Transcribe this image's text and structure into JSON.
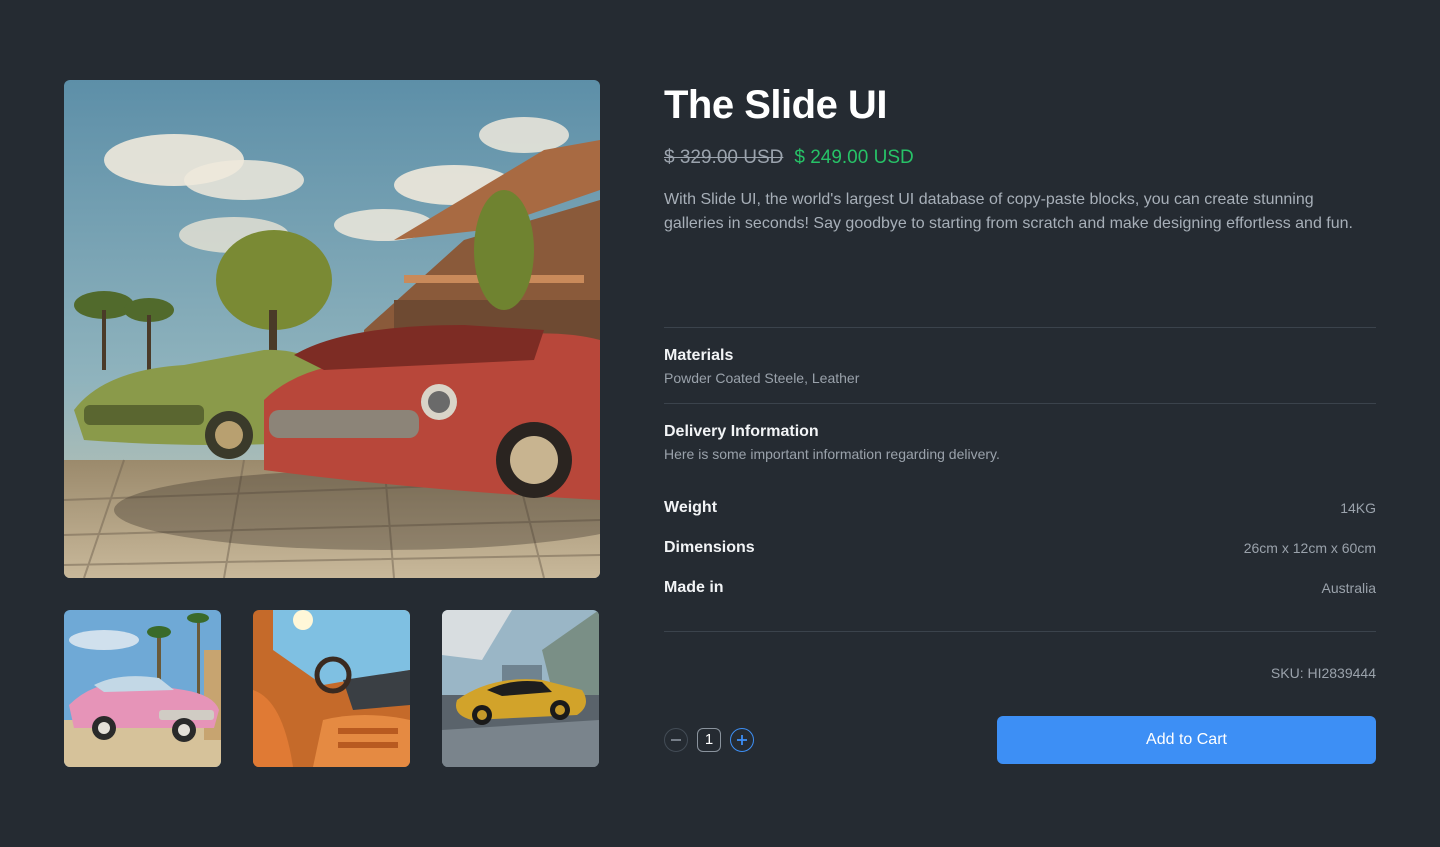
{
  "product": {
    "title": "The Slide UI",
    "price_original": "$ 329.00 USD",
    "price_sale": "$ 249.00 USD",
    "description": "With Slide UI, the world's largest UI database of copy-paste blocks, you can create stunning galleries in seconds! Say goodbye to starting from scratch and make designing effortless and fun."
  },
  "gallery": {
    "main_image": "vintage-cars-photo",
    "thumbnails": [
      "pink-classic-car-photo",
      "orange-car-interior-photo",
      "gold-supercar-photo"
    ]
  },
  "info_sections": [
    {
      "title": "Materials",
      "text": "Powder Coated Steele, Leather"
    },
    {
      "title": "Delivery Information",
      "text": "Here is some important information regarding delivery."
    }
  ],
  "specs": [
    {
      "label": "Weight",
      "value": "14KG"
    },
    {
      "label": "Dimensions",
      "value": "26cm x 12cm x 60cm"
    },
    {
      "label": "Made in",
      "value": "Australia"
    }
  ],
  "sku": "SKU: HI2839444",
  "quantity": {
    "value": "1",
    "decrease_icon": "minus-icon",
    "increase_icon": "plus-icon"
  },
  "cart": {
    "add_label": "Add to Cart"
  },
  "colors": {
    "background": "#252b32",
    "sale_price": "#27c267",
    "accent": "#3d8ff5"
  }
}
